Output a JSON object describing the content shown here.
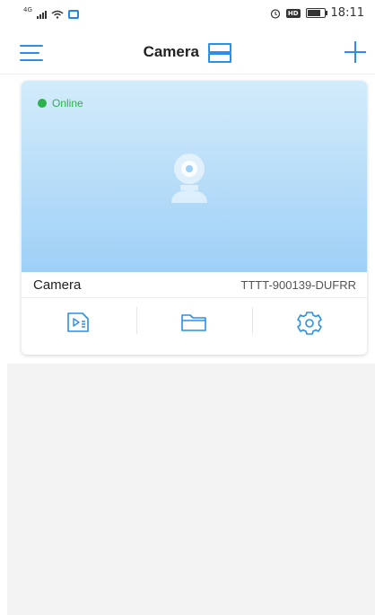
{
  "status_bar": {
    "network": "4G",
    "time": "18:11",
    "hd_badge": "HD"
  },
  "header": {
    "title": "Camera"
  },
  "device_card": {
    "status": "Online",
    "name": "Camera",
    "device_id": "TTTT-900139-DUFRR"
  },
  "colors": {
    "accent": "#2b8fe5",
    "online": "#2bb24c",
    "preview_top": "#d3ecfb",
    "preview_bottom": "#9ed0f7"
  },
  "icons": {
    "menu": "hamburger-icon",
    "layout": "layout-toggle-icon",
    "add": "plus-icon",
    "playback": "video-playback-icon",
    "files": "folder-icon",
    "settings": "gear-icon"
  }
}
